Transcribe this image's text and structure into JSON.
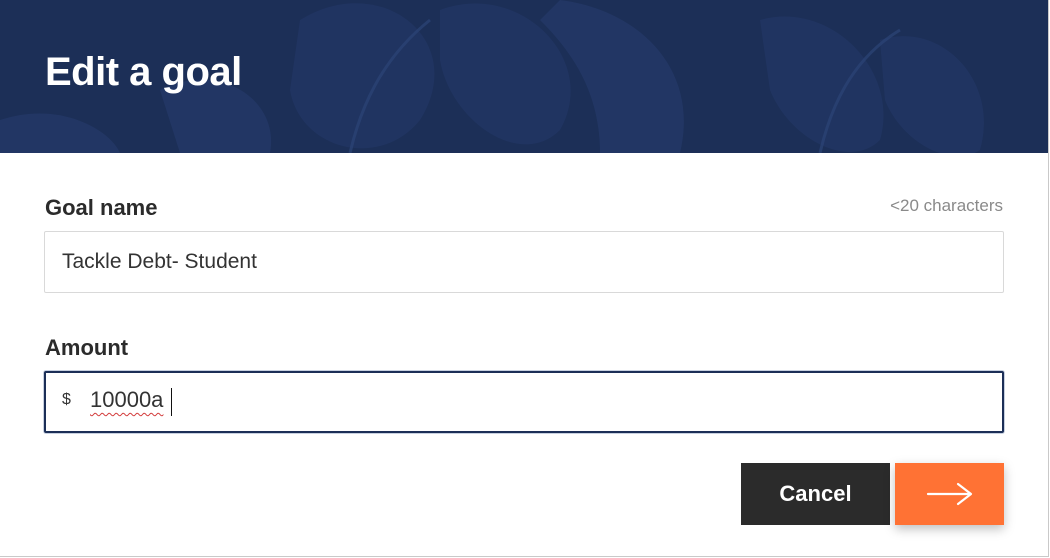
{
  "dialog": {
    "title": "Edit a goal"
  },
  "goal_name": {
    "label": "Goal name",
    "hint": "<20 characters",
    "value": "Tackle Debt- Student"
  },
  "amount": {
    "label": "Amount",
    "currency_symbol": "$",
    "value": "10000a"
  },
  "actions": {
    "cancel_label": "Cancel",
    "next_icon": "arrow-right-icon"
  },
  "colors": {
    "header_bg": "#1c2f57",
    "cancel_bg": "#2b2b2b",
    "accent": "#ff7234",
    "focus_border": "#1c2f57"
  }
}
